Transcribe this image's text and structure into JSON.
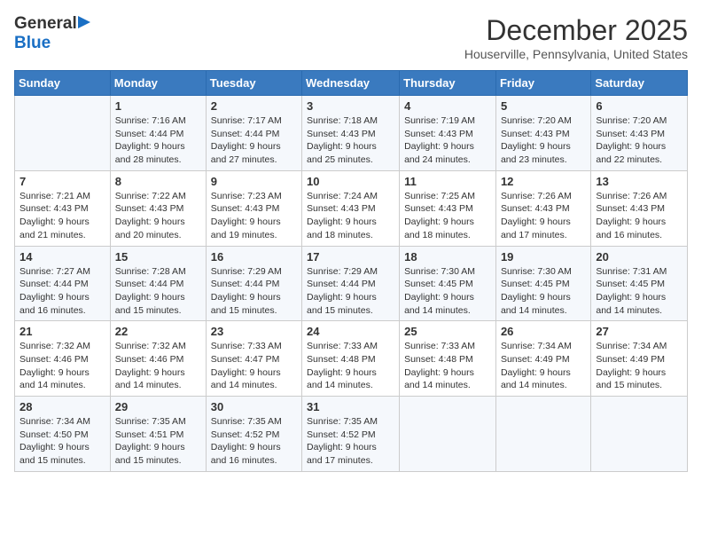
{
  "header": {
    "logo_general": "General",
    "logo_blue": "Blue",
    "month": "December 2025",
    "location": "Houserville, Pennsylvania, United States"
  },
  "days_of_week": [
    "Sunday",
    "Monday",
    "Tuesday",
    "Wednesday",
    "Thursday",
    "Friday",
    "Saturday"
  ],
  "weeks": [
    [
      {
        "day": "",
        "sunrise": "",
        "sunset": "",
        "daylight": ""
      },
      {
        "day": "1",
        "sunrise": "Sunrise: 7:16 AM",
        "sunset": "Sunset: 4:44 PM",
        "daylight": "Daylight: 9 hours and 28 minutes."
      },
      {
        "day": "2",
        "sunrise": "Sunrise: 7:17 AM",
        "sunset": "Sunset: 4:44 PM",
        "daylight": "Daylight: 9 hours and 27 minutes."
      },
      {
        "day": "3",
        "sunrise": "Sunrise: 7:18 AM",
        "sunset": "Sunset: 4:43 PM",
        "daylight": "Daylight: 9 hours and 25 minutes."
      },
      {
        "day": "4",
        "sunrise": "Sunrise: 7:19 AM",
        "sunset": "Sunset: 4:43 PM",
        "daylight": "Daylight: 9 hours and 24 minutes."
      },
      {
        "day": "5",
        "sunrise": "Sunrise: 7:20 AM",
        "sunset": "Sunset: 4:43 PM",
        "daylight": "Daylight: 9 hours and 23 minutes."
      },
      {
        "day": "6",
        "sunrise": "Sunrise: 7:20 AM",
        "sunset": "Sunset: 4:43 PM",
        "daylight": "Daylight: 9 hours and 22 minutes."
      }
    ],
    [
      {
        "day": "7",
        "sunrise": "Sunrise: 7:21 AM",
        "sunset": "Sunset: 4:43 PM",
        "daylight": "Daylight: 9 hours and 21 minutes."
      },
      {
        "day": "8",
        "sunrise": "Sunrise: 7:22 AM",
        "sunset": "Sunset: 4:43 PM",
        "daylight": "Daylight: 9 hours and 20 minutes."
      },
      {
        "day": "9",
        "sunrise": "Sunrise: 7:23 AM",
        "sunset": "Sunset: 4:43 PM",
        "daylight": "Daylight: 9 hours and 19 minutes."
      },
      {
        "day": "10",
        "sunrise": "Sunrise: 7:24 AM",
        "sunset": "Sunset: 4:43 PM",
        "daylight": "Daylight: 9 hours and 18 minutes."
      },
      {
        "day": "11",
        "sunrise": "Sunrise: 7:25 AM",
        "sunset": "Sunset: 4:43 PM",
        "daylight": "Daylight: 9 hours and 18 minutes."
      },
      {
        "day": "12",
        "sunrise": "Sunrise: 7:26 AM",
        "sunset": "Sunset: 4:43 PM",
        "daylight": "Daylight: 9 hours and 17 minutes."
      },
      {
        "day": "13",
        "sunrise": "Sunrise: 7:26 AM",
        "sunset": "Sunset: 4:43 PM",
        "daylight": "Daylight: 9 hours and 16 minutes."
      }
    ],
    [
      {
        "day": "14",
        "sunrise": "Sunrise: 7:27 AM",
        "sunset": "Sunset: 4:44 PM",
        "daylight": "Daylight: 9 hours and 16 minutes."
      },
      {
        "day": "15",
        "sunrise": "Sunrise: 7:28 AM",
        "sunset": "Sunset: 4:44 PM",
        "daylight": "Daylight: 9 hours and 15 minutes."
      },
      {
        "day": "16",
        "sunrise": "Sunrise: 7:29 AM",
        "sunset": "Sunset: 4:44 PM",
        "daylight": "Daylight: 9 hours and 15 minutes."
      },
      {
        "day": "17",
        "sunrise": "Sunrise: 7:29 AM",
        "sunset": "Sunset: 4:44 PM",
        "daylight": "Daylight: 9 hours and 15 minutes."
      },
      {
        "day": "18",
        "sunrise": "Sunrise: 7:30 AM",
        "sunset": "Sunset: 4:45 PM",
        "daylight": "Daylight: 9 hours and 14 minutes."
      },
      {
        "day": "19",
        "sunrise": "Sunrise: 7:30 AM",
        "sunset": "Sunset: 4:45 PM",
        "daylight": "Daylight: 9 hours and 14 minutes."
      },
      {
        "day": "20",
        "sunrise": "Sunrise: 7:31 AM",
        "sunset": "Sunset: 4:45 PM",
        "daylight": "Daylight: 9 hours and 14 minutes."
      }
    ],
    [
      {
        "day": "21",
        "sunrise": "Sunrise: 7:32 AM",
        "sunset": "Sunset: 4:46 PM",
        "daylight": "Daylight: 9 hours and 14 minutes."
      },
      {
        "day": "22",
        "sunrise": "Sunrise: 7:32 AM",
        "sunset": "Sunset: 4:46 PM",
        "daylight": "Daylight: 9 hours and 14 minutes."
      },
      {
        "day": "23",
        "sunrise": "Sunrise: 7:33 AM",
        "sunset": "Sunset: 4:47 PM",
        "daylight": "Daylight: 9 hours and 14 minutes."
      },
      {
        "day": "24",
        "sunrise": "Sunrise: 7:33 AM",
        "sunset": "Sunset: 4:48 PM",
        "daylight": "Daylight: 9 hours and 14 minutes."
      },
      {
        "day": "25",
        "sunrise": "Sunrise: 7:33 AM",
        "sunset": "Sunset: 4:48 PM",
        "daylight": "Daylight: 9 hours and 14 minutes."
      },
      {
        "day": "26",
        "sunrise": "Sunrise: 7:34 AM",
        "sunset": "Sunset: 4:49 PM",
        "daylight": "Daylight: 9 hours and 14 minutes."
      },
      {
        "day": "27",
        "sunrise": "Sunrise: 7:34 AM",
        "sunset": "Sunset: 4:49 PM",
        "daylight": "Daylight: 9 hours and 15 minutes."
      }
    ],
    [
      {
        "day": "28",
        "sunrise": "Sunrise: 7:34 AM",
        "sunset": "Sunset: 4:50 PM",
        "daylight": "Daylight: 9 hours and 15 minutes."
      },
      {
        "day": "29",
        "sunrise": "Sunrise: 7:35 AM",
        "sunset": "Sunset: 4:51 PM",
        "daylight": "Daylight: 9 hours and 15 minutes."
      },
      {
        "day": "30",
        "sunrise": "Sunrise: 7:35 AM",
        "sunset": "Sunset: 4:52 PM",
        "daylight": "Daylight: 9 hours and 16 minutes."
      },
      {
        "day": "31",
        "sunrise": "Sunrise: 7:35 AM",
        "sunset": "Sunset: 4:52 PM",
        "daylight": "Daylight: 9 hours and 17 minutes."
      },
      {
        "day": "",
        "sunrise": "",
        "sunset": "",
        "daylight": ""
      },
      {
        "day": "",
        "sunrise": "",
        "sunset": "",
        "daylight": ""
      },
      {
        "day": "",
        "sunrise": "",
        "sunset": "",
        "daylight": ""
      }
    ]
  ]
}
